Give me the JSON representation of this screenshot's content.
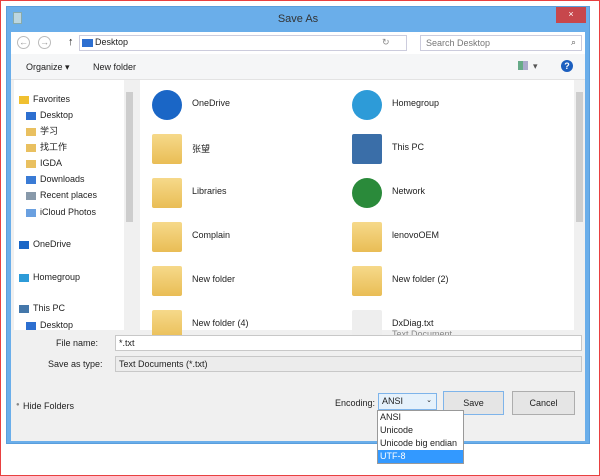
{
  "window": {
    "title": "Save As",
    "close": "×"
  },
  "nav": {
    "back": "←",
    "forward": "→",
    "up": "↑",
    "address": "Desktop",
    "refresh": "↻",
    "search_placeholder": "Search Desktop"
  },
  "toolbar": {
    "organize": "Organize ▾",
    "new_folder": "New folder",
    "view": "▾",
    "help": "?"
  },
  "sidebar": {
    "items": [
      {
        "label": "Favorites",
        "icon": "star-icon"
      },
      {
        "label": "Desktop",
        "icon": "desktop-icon"
      },
      {
        "label": "学习",
        "icon": "folder-icon"
      },
      {
        "label": "找工作",
        "icon": "folder-icon"
      },
      {
        "label": "IGDA",
        "icon": "folder-icon"
      },
      {
        "label": "Downloads",
        "icon": "downloads-icon"
      },
      {
        "label": "Recent places",
        "icon": "recent-icon"
      },
      {
        "label": "iCloud Photos",
        "icon": "icloud-icon"
      },
      {
        "label": "OneDrive",
        "icon": "onedrive-icon"
      },
      {
        "label": "Homegroup",
        "icon": "homegroup-icon"
      },
      {
        "label": "This PC",
        "icon": "pc-icon"
      },
      {
        "label": "Desktop",
        "icon": "desktop-icon"
      }
    ]
  },
  "files": [
    {
      "name": "OneDrive",
      "icon": "onedrive-icon"
    },
    {
      "name": "Homegroup",
      "icon": "homegroup-icon"
    },
    {
      "name": "张望",
      "icon": "user-folder-icon"
    },
    {
      "name": "This PC",
      "icon": "pc-icon"
    },
    {
      "name": "Libraries",
      "icon": "libraries-icon"
    },
    {
      "name": "Network",
      "icon": "network-icon"
    },
    {
      "name": "Complain",
      "icon": "folder-icon"
    },
    {
      "name": "lenovoOEM",
      "icon": "folder-icon"
    },
    {
      "name": "New folder",
      "icon": "folder-icon"
    },
    {
      "name": "New folder (2)",
      "icon": "folder-icon"
    },
    {
      "name": "New folder (4)",
      "icon": "folder-icon"
    },
    {
      "name": "DxDiag.txt",
      "icon": "text-file-icon",
      "type": "Text Document"
    }
  ],
  "form": {
    "file_name_label": "File name:",
    "file_name": "*.txt",
    "type_label": "Save as type:",
    "type": "Text Documents (*.txt)",
    "encoding_label": "Encoding:",
    "encoding": "ANSI"
  },
  "buttons": {
    "hide_folders": "Hide Folders",
    "save": "Save",
    "cancel": "Cancel"
  },
  "encoding_options": [
    "ANSI",
    "Unicode",
    "Unicode big endian",
    "UTF-8"
  ],
  "colors": {
    "title_bar": "#6aaeea",
    "close": "#c7474c",
    "selected": "#3399ff"
  }
}
